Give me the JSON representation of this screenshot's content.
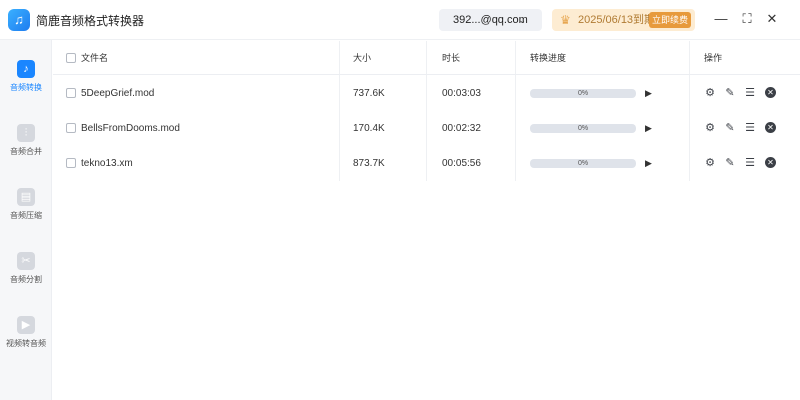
{
  "app": {
    "title": "简鹿音频格式转换器",
    "account": "392...@qq.com",
    "vip_expire": "2025/06/13到期",
    "vip_renew": "立即续费"
  },
  "window_controls": {
    "minimize": "—",
    "maximize": "⛶",
    "close": "✕"
  },
  "sidebar": {
    "items": [
      {
        "label": "音频转换",
        "icon": "music-note-icon",
        "active": true
      },
      {
        "label": "音频合并",
        "icon": "audio-merge-icon",
        "active": false
      },
      {
        "label": "音频压缩",
        "icon": "audio-compress-icon",
        "active": false
      },
      {
        "label": "音频分割",
        "icon": "scissors-icon",
        "active": false
      },
      {
        "label": "视频转音频",
        "icon": "video-icon",
        "active": false
      }
    ]
  },
  "table": {
    "headers": {
      "filename": "文件名",
      "size": "大小",
      "duration": "时长",
      "progress": "转换进度",
      "actions": "操作"
    },
    "rows": [
      {
        "filename": "5DeepGrief.mod",
        "size": "737.6K",
        "duration": "00:03:03",
        "progress_text": "0%",
        "progress": 0
      },
      {
        "filename": "BellsFromDooms.mod",
        "size": "170.4K",
        "duration": "00:02:32",
        "progress_text": "0%",
        "progress": 0
      },
      {
        "filename": "tekno13.xm",
        "size": "873.7K",
        "duration": "00:05:56",
        "progress_text": "0%",
        "progress": 0
      }
    ]
  },
  "colors": {
    "accent": "#1a86ff",
    "vip_bg": "#fdecd2",
    "vip_button": "#e79a3c"
  }
}
